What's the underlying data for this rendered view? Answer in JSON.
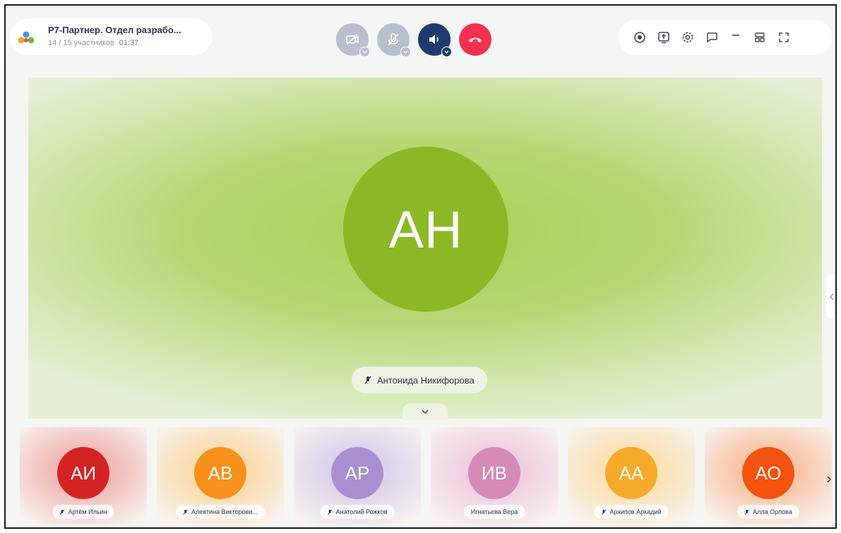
{
  "conference": {
    "title": "Р7-Партнер. Отдел разрабо...",
    "participants": "14 / 15 участников",
    "timer": "01:37"
  },
  "controls": [
    {
      "name": "camera-toggle-button",
      "icon": "camera-off-icon",
      "state": "disabled"
    },
    {
      "name": "microphone-toggle-button",
      "icon": "microphone-off-icon",
      "state": "disabled"
    },
    {
      "name": "speaker-toggle-button",
      "icon": "speaker-icon",
      "state": "active"
    },
    {
      "name": "hang-up-button",
      "icon": "phone-hangup-icon",
      "state": "danger"
    }
  ],
  "tools": [
    "record-icon",
    "screen-share-icon",
    "settings-icon",
    "chat-icon",
    "minimize-icon",
    "layout-icon",
    "fullscreen-icon"
  ],
  "active_speaker": {
    "initials": "АН",
    "name": "Антонида Никифорова",
    "color": "#8cb825"
  },
  "thumbnails": [
    {
      "initials": "АИ",
      "name": "Артём Ильин",
      "muted": true,
      "color": "#d32424",
      "bg": "#f2b9b6"
    },
    {
      "initials": "АВ",
      "name": "Алевтина Викторови...",
      "muted": true,
      "color": "#f7911c",
      "bg": "#fbdcae"
    },
    {
      "initials": "АР",
      "name": "Анатолий Рожков",
      "muted": true,
      "color": "#a98fd0",
      "bg": "#ddd3ec"
    },
    {
      "initials": "ИВ",
      "name": "Игнатьева Вера",
      "muted": false,
      "color": "#d58aba",
      "bg": "#f0cfe1"
    },
    {
      "initials": "АА",
      "name": "Архипов Аркадий",
      "muted": true,
      "color": "#f6aa2a",
      "bg": "#fbe2b5"
    },
    {
      "initials": "АО",
      "name": "Алла Орлова",
      "muted": true,
      "color": "#f3520f",
      "bg": "#f9c5a6"
    }
  ],
  "colors": {
    "accent_dark": "#1d3c6d",
    "hangup": "#f4324f",
    "stage_green": "#a9d055"
  }
}
